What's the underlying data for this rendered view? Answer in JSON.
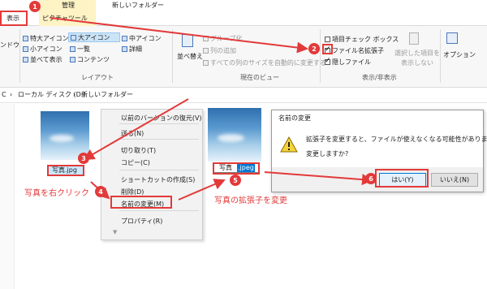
{
  "titlebar": {
    "context_tab": "管理",
    "folder_title": "新しいフォルダー"
  },
  "tabs": {
    "view": "表示",
    "picture_tools": "ピクチャツール"
  },
  "ribbon": {
    "left_cut": "ンドウ",
    "layout_items": [
      "特大アイコン",
      "大アイコン",
      "中アイコン",
      "小アイコン",
      "一覧",
      "詳細",
      "並べて表示",
      "コンテンツ"
    ],
    "layout_group": "レイアウト",
    "sort_label": "並べ替え",
    "group_by": "グループ化",
    "add_column": "列の追加",
    "fit_columns": "すべての列のサイズを自動的に変更する",
    "current_view_group": "現在のビュー",
    "item_checkbox": "項目チェック ボックス",
    "file_ext": "ファイル名拡張子",
    "hidden_files": "隠しファイル",
    "hide_selected": [
      "選択した項目を",
      "表示しない"
    ],
    "options": "オプション",
    "showhide_group": "表示/非表示"
  },
  "address": {
    "parts": [
      "C",
      "ローカル ディスク (D:)",
      "新しいフォルダー"
    ]
  },
  "files": {
    "file1_name": "写真.jpg",
    "file2_name_a": "写真",
    "file2_name_b": ".jpeg"
  },
  "context_menu": [
    "以前のバージョンの復元(V)",
    "送る(N)",
    "切り取り(T)",
    "コピー(C)",
    "ショートカットの作成(S)",
    "削除(D)",
    "名前の変更(M)",
    "プロパティ(R)"
  ],
  "dialog": {
    "title": "名前の変更",
    "message": "拡張子を変更すると、ファイルが使えなくなる可能性があります。",
    "question": "変更しますか?",
    "yes": "はい(Y)",
    "no": "いいえ(N)"
  },
  "annotations": {
    "badges": [
      "1",
      "2",
      "3",
      "4",
      "5",
      "6"
    ],
    "right_click_note": "写真を右クリック",
    "change_ext_note": "写真の拡張子を変更",
    "color": "#e23a3a"
  }
}
